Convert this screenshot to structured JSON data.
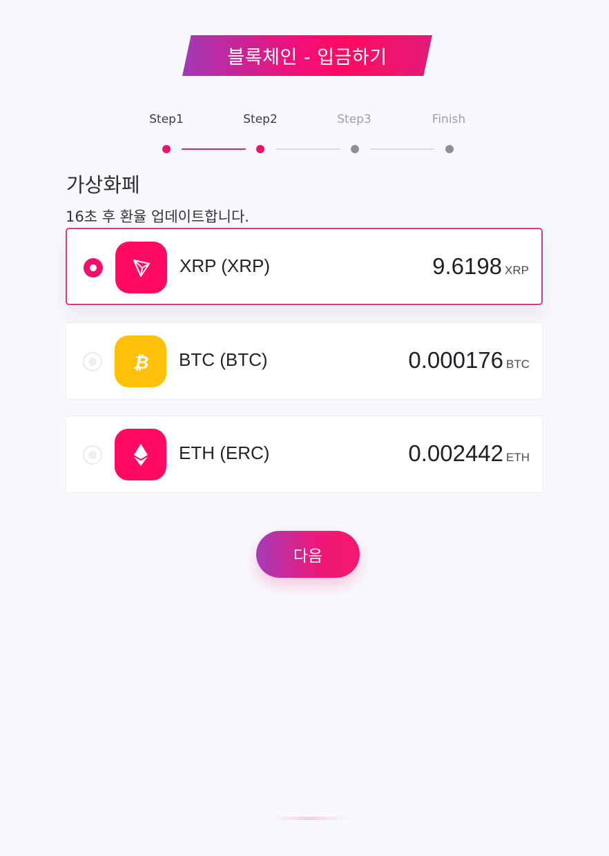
{
  "header": {
    "title": "블록체인 - 입금하기"
  },
  "stepper": {
    "steps": [
      {
        "label": "Step1",
        "active": true
      },
      {
        "label": "Step2",
        "active": true
      },
      {
        "label": "Step3",
        "active": false
      },
      {
        "label": "Finish",
        "active": false
      }
    ]
  },
  "section": {
    "title": "가상화페",
    "update_note": "16초 후 환율 업데이트합니다."
  },
  "coins": [
    {
      "name": "XRP (XRP)",
      "value": "9.6198",
      "unit": "XRP",
      "selected": true,
      "icon": "tron-icon",
      "color": "#ff0a62"
    },
    {
      "name": "BTC (BTC)",
      "value": "0.000176",
      "unit": "BTC",
      "selected": false,
      "icon": "bitcoin-icon",
      "color": "#ffc107"
    },
    {
      "name": "ETH (ERC)",
      "value": "0.002442",
      "unit": "ETH",
      "selected": false,
      "icon": "ethereum-icon",
      "color": "#ff0a62"
    }
  ],
  "actions": {
    "next_label": "다음"
  },
  "colors": {
    "accent": "#f0106e",
    "brand_gradient_start": "#a03ab4",
    "btc": "#ffc107"
  }
}
